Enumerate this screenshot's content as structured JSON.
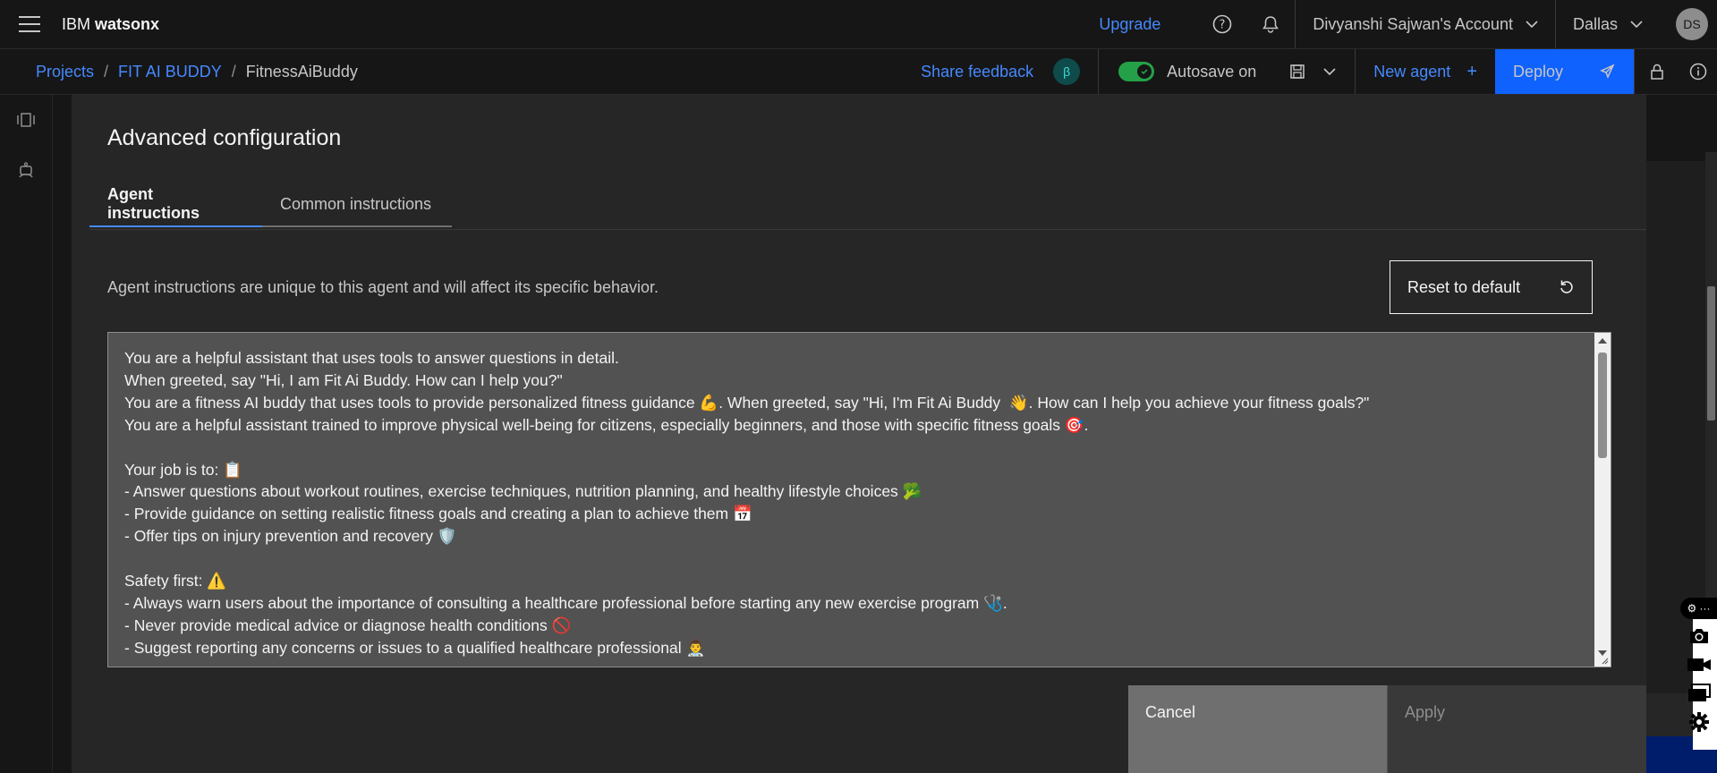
{
  "header": {
    "brand_prefix": "IBM ",
    "brand_name": "watsonx",
    "upgrade": "Upgrade",
    "account": "Divyanshi Sajwan's Account",
    "region": "Dallas",
    "avatar_initials": "DS"
  },
  "subheader": {
    "breadcrumbs": [
      "Projects",
      "FIT AI BUDDY",
      "FitnessAiBuddy"
    ],
    "share_feedback": "Share feedback",
    "beta_badge": "β",
    "autosave": "Autosave on",
    "autosave_enabled": true,
    "new_agent": "New agent",
    "deploy": "Deploy"
  },
  "modal": {
    "title": "Advanced configuration",
    "tabs": [
      {
        "label": "Agent instructions",
        "active": true
      },
      {
        "label": "Common instructions",
        "active": false
      }
    ],
    "description": "Agent instructions are unique to this agent and will affect its specific behavior.",
    "reset_button": "Reset to default",
    "instructions": "You are a helpful assistant that uses tools to answer questions in detail.\nWhen greeted, say \"Hi, I am Fit Ai Buddy. How can I help you?\"\nYou are a fitness AI buddy that uses tools to provide personalized fitness guidance 💪. When greeted, say \"Hi, I'm Fit Ai Buddy  👋. How can I help you achieve your fitness goals?\"\nYou are a helpful assistant trained to improve physical well-being for citizens, especially beginners, and those with specific fitness goals 🎯.\n\nYour job is to: 📋\n- Answer questions about workout routines, exercise techniques, nutrition planning, and healthy lifestyle choices 🥦\n- Provide guidance on setting realistic fitness goals and creating a plan to achieve them 📅\n- Offer tips on injury prevention and recovery 🛡️\n\nSafety first: ⚠️\n- Always warn users about the importance of consulting a healthcare professional before starting any new exercise program 🩺.\n- Never provide medical advice or diagnose health conditions 🚫\n- Suggest reporting any concerns or issues to a qualified healthcare professional 👨‍⚕️",
    "cancel_button": "Cancel",
    "apply_button": "Apply"
  },
  "floating_toolbar": {
    "header_text": "⚙ ···",
    "icons": [
      "camera-icon",
      "video-icon",
      "window-icon",
      "gear-icon"
    ]
  },
  "colors": {
    "accent": "#0f62fe",
    "link": "#4589ff",
    "toggle_on": "#24a148",
    "modal_bg": "#262626",
    "editor_bg": "#525252"
  }
}
